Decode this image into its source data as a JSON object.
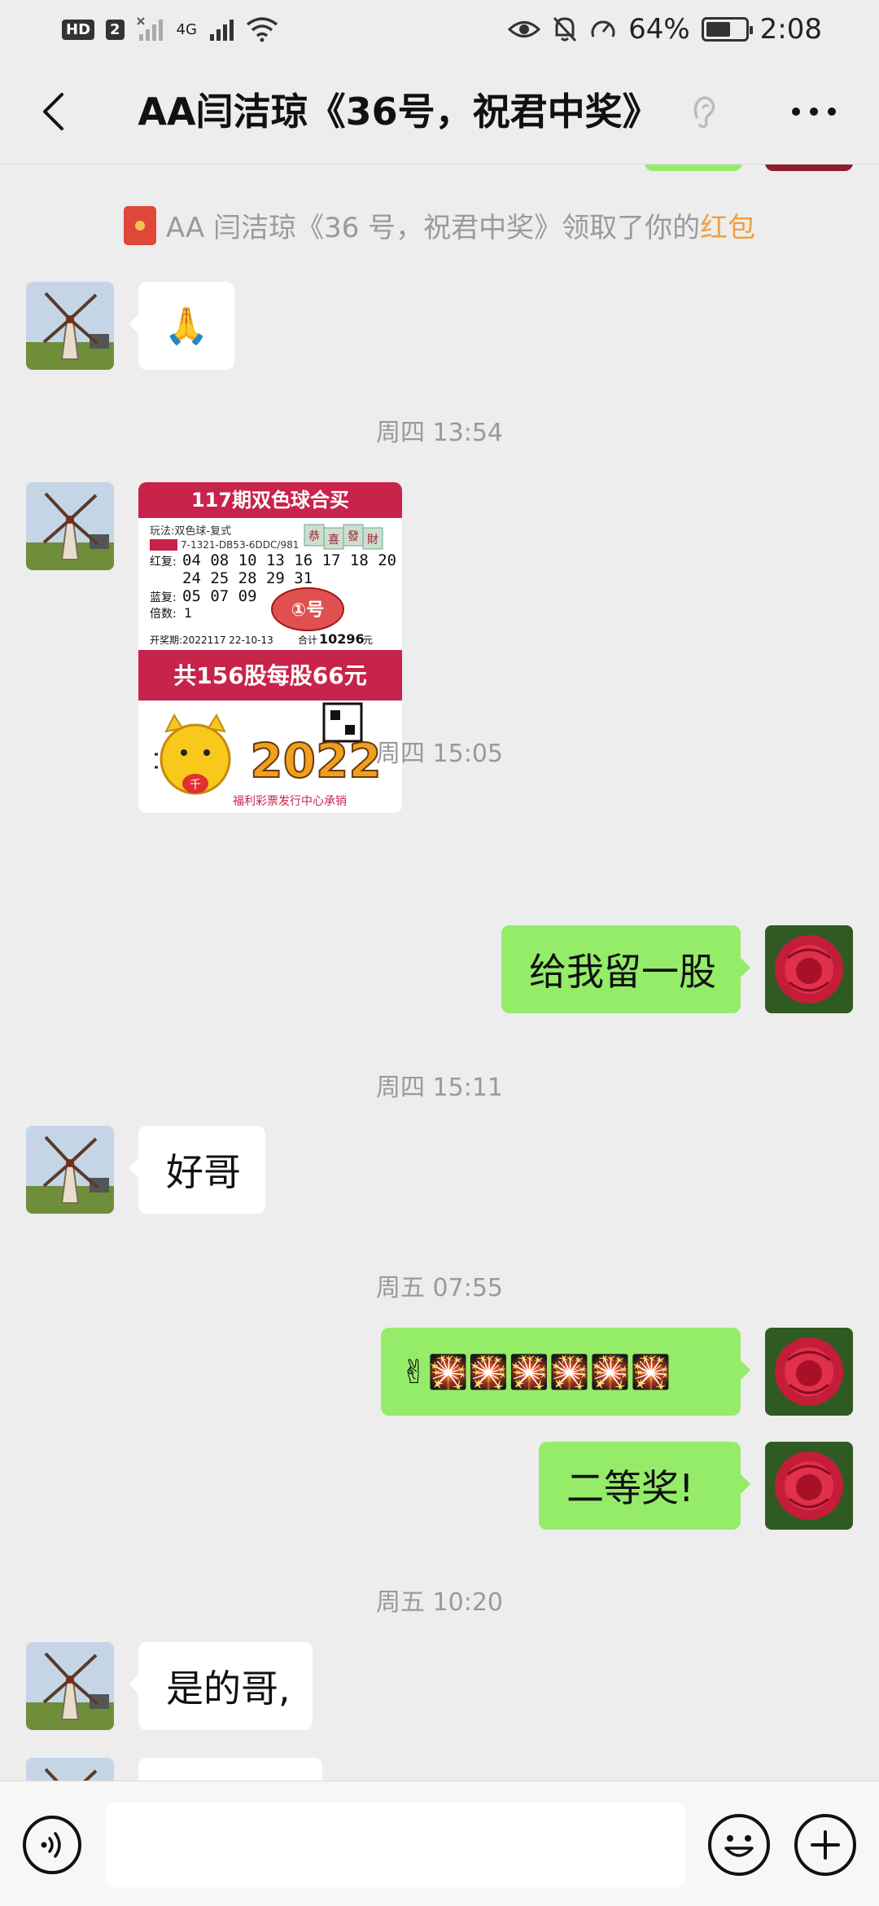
{
  "status_bar": {
    "hd": "HD",
    "hd_num": "2",
    "network": "4G",
    "battery_percent": "64%",
    "battery_level": 0.64,
    "time": "2:08"
  },
  "header": {
    "title": "AA闫洁琼《36号，祝君中奖》"
  },
  "system_note": {
    "text": "AA 闫洁琼《36 号，祝君中奖》领取了你的",
    "link": "红包"
  },
  "messages": {
    "m1_emoji": "🙏",
    "ts1": "周四 13:54",
    "ts2": "周四 15:05",
    "m3_text": "给我留一股",
    "ts3": "周四 15:11",
    "m4_text": "好哥",
    "ts4": "周五 07:55",
    "m5_text": "✌🎇🎇🎇🎇🎇🎇",
    "m6_text": "二等奖!",
    "ts5": "周五 10:20",
    "m7_text": "是的哥,"
  },
  "ticket": {
    "banner_top": "117期双色球合买",
    "play_type": "玩法:双色球-复式",
    "serial": "7-1321-DB53-6DDC/981",
    "red_label": "红复:",
    "red_row1": "04 08 10 13 16 17 18 20",
    "red_row2": "24 25 28 29 31",
    "blue_label": "蓝复:",
    "blue_row": "05 07 09",
    "multiple_label": "倍数:",
    "multiple": "1",
    "stamp": "①号",
    "tags": [
      "恭",
      "喜",
      "發",
      "財"
    ],
    "draw_period": "开奖期:2022117 22-10-13",
    "total_label": "合计",
    "total": "10296",
    "total_unit": "元",
    "banner_mid": "共156股每股66元",
    "year": "2022",
    "mascot_char": "千",
    "footer": "福利彩票发行中心承销"
  },
  "colors": {
    "bg": "#ededed",
    "bubble_out": "#95ec69",
    "bubble_in": "#ffffff",
    "link": "#f0a040",
    "ticket_red": "#c8234a"
  },
  "icons": [
    "back-arrow-icon",
    "ear-icon",
    "more-icon",
    "voice-icon",
    "emoji-icon",
    "plus-icon"
  ]
}
